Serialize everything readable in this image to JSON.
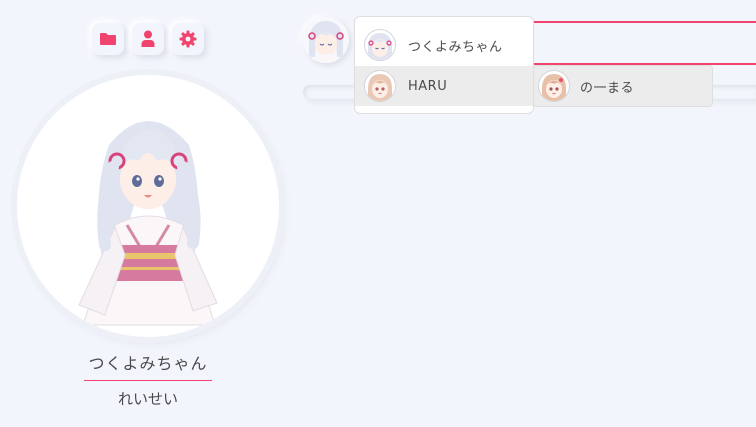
{
  "toolbar": {
    "icons": [
      "folder-icon",
      "user-icon",
      "gear-icon"
    ]
  },
  "character": {
    "name": "つくよみちゃん",
    "subname": "れいせい"
  },
  "dropdown": {
    "options": [
      {
        "label": "つくよみちゃん"
      },
      {
        "label": "HARU"
      }
    ]
  },
  "floating_option": {
    "label": "の一まる"
  },
  "colors": {
    "accent": "#f0446f",
    "background": "#f3f5fc"
  }
}
